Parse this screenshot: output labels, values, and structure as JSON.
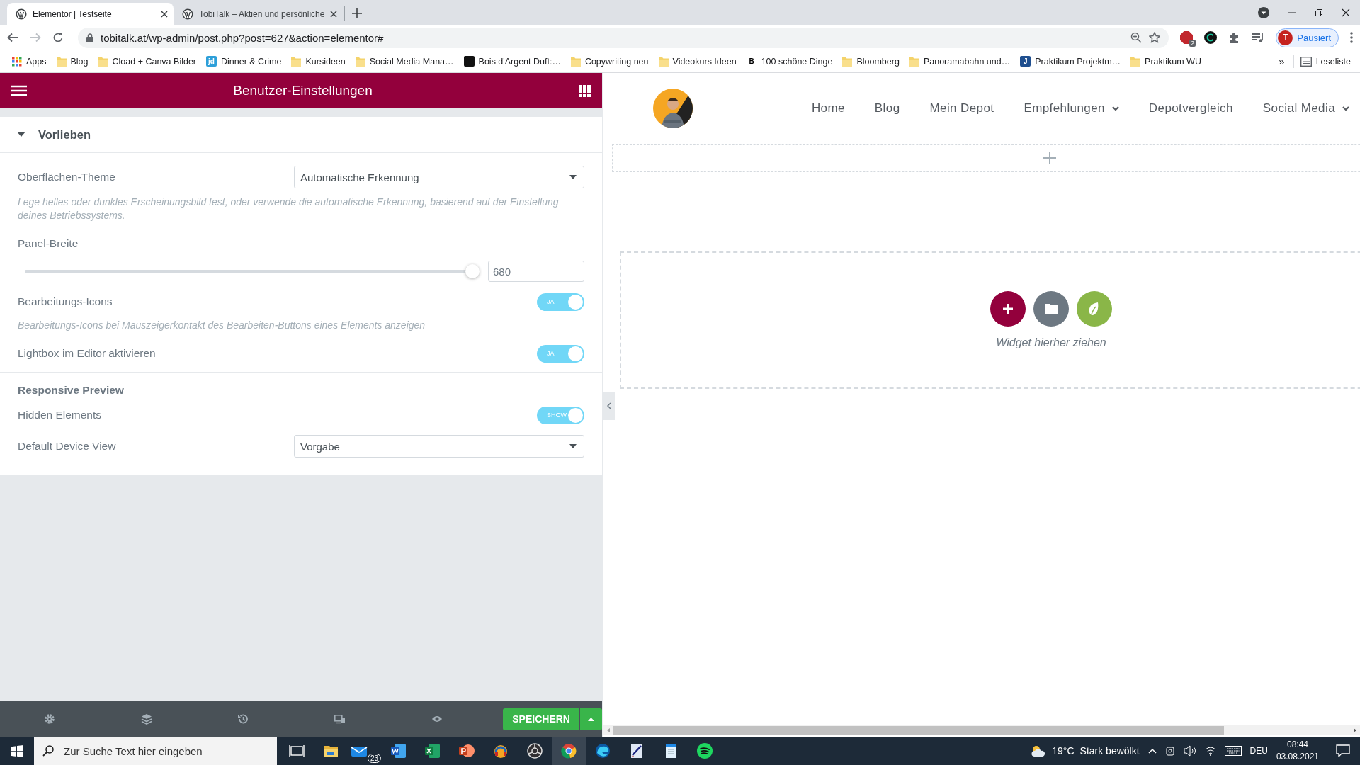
{
  "browser": {
    "tabs": [
      {
        "title": "Elementor | Testseite",
        "selected": true
      },
      {
        "title": "TobiTalk – Aktien und persönliche",
        "selected": false
      }
    ],
    "url": "tobitalk.at/wp-admin/post.php?post=627&action=elementor#",
    "extension_badge": "2",
    "profile": {
      "initial": "T",
      "label": "Pausiert"
    },
    "bookmarks": [
      {
        "kind": "apps",
        "label": "Apps"
      },
      {
        "kind": "folder",
        "label": "Blog"
      },
      {
        "kind": "folder",
        "label": "Cload + Canva Bilder"
      },
      {
        "kind": "site",
        "label": "Dinner & Crime",
        "icon_text": "jd",
        "color": "#2d9fd9"
      },
      {
        "kind": "folder",
        "label": "Kursideen"
      },
      {
        "kind": "folder",
        "label": "Social Media Mana…"
      },
      {
        "kind": "site",
        "label": "Bois d'Argent Duft:…",
        "color": "#111111"
      },
      {
        "kind": "folder",
        "label": "Copywriting neu"
      },
      {
        "kind": "folder",
        "label": "Videokurs Ideen"
      },
      {
        "kind": "site",
        "label": "100 schöne Dinge",
        "icon_text": "B",
        "color": "#ffffff"
      },
      {
        "kind": "folder",
        "label": "Bloomberg"
      },
      {
        "kind": "folder",
        "label": "Panoramabahn und…"
      },
      {
        "kind": "site",
        "label": "Praktikum Projektm…",
        "icon_text": "J",
        "color": "#1f4f8f"
      },
      {
        "kind": "folder",
        "label": "Praktikum WU"
      }
    ],
    "overflow": "»",
    "reading_list": "Leseliste"
  },
  "panel": {
    "title": "Benutzer-Einstellungen",
    "section": {
      "title": "Vorlieben",
      "expanded": true
    },
    "controls": [
      {
        "kind": "select",
        "label": "Oberflächen-Theme",
        "value": "Automatische Erkennung"
      },
      {
        "kind": "note",
        "text": "Lege helles oder dunkles Erscheinungsbild fest, oder verwende die automatische Erkennung, basierend auf der Einstellung deines Betriebssystems."
      },
      {
        "kind": "slider",
        "label": "Panel-Breite",
        "level": 1,
        "value": "680"
      },
      {
        "kind": "toggle",
        "label": "Bearbeitungs-Icons",
        "on": true,
        "toggle_text": "JA"
      },
      {
        "kind": "note",
        "text": "Bearbeitungs-Icons bei Mauszeigerkontakt des Bearbeiten-Buttons eines Elements anzeigen"
      },
      {
        "kind": "toggle",
        "label": "Lightbox im Editor aktivieren",
        "on": true,
        "toggle_text": "JA"
      },
      {
        "kind": "heading",
        "text": "Responsive Preview"
      },
      {
        "kind": "toggle",
        "label": "Hidden Elements",
        "on": true,
        "toggle_text": "SHOW"
      },
      {
        "kind": "select",
        "label": "Default Device View",
        "value": "Vorgabe"
      }
    ],
    "save_button": "SPEICHERN"
  },
  "canvas": {
    "nav": [
      {
        "label": "Home",
        "dropdown": false
      },
      {
        "label": "Blog",
        "dropdown": false
      },
      {
        "label": "Mein Depot",
        "dropdown": false
      },
      {
        "label": "Empfehlungen",
        "dropdown": true
      },
      {
        "label": "Depotvergleich",
        "dropdown": false
      },
      {
        "label": "Social Media",
        "dropdown": true
      }
    ],
    "drop_hint": "Widget hierher ziehen"
  },
  "taskbar": {
    "search_placeholder": "Zur Suche Text hier eingeben",
    "mail_badge": "23",
    "weather": {
      "temperature": "19°C",
      "condition": "Stark bewölkt"
    },
    "language": "DEU",
    "time": "08:44",
    "date": "03.08.2021"
  }
}
